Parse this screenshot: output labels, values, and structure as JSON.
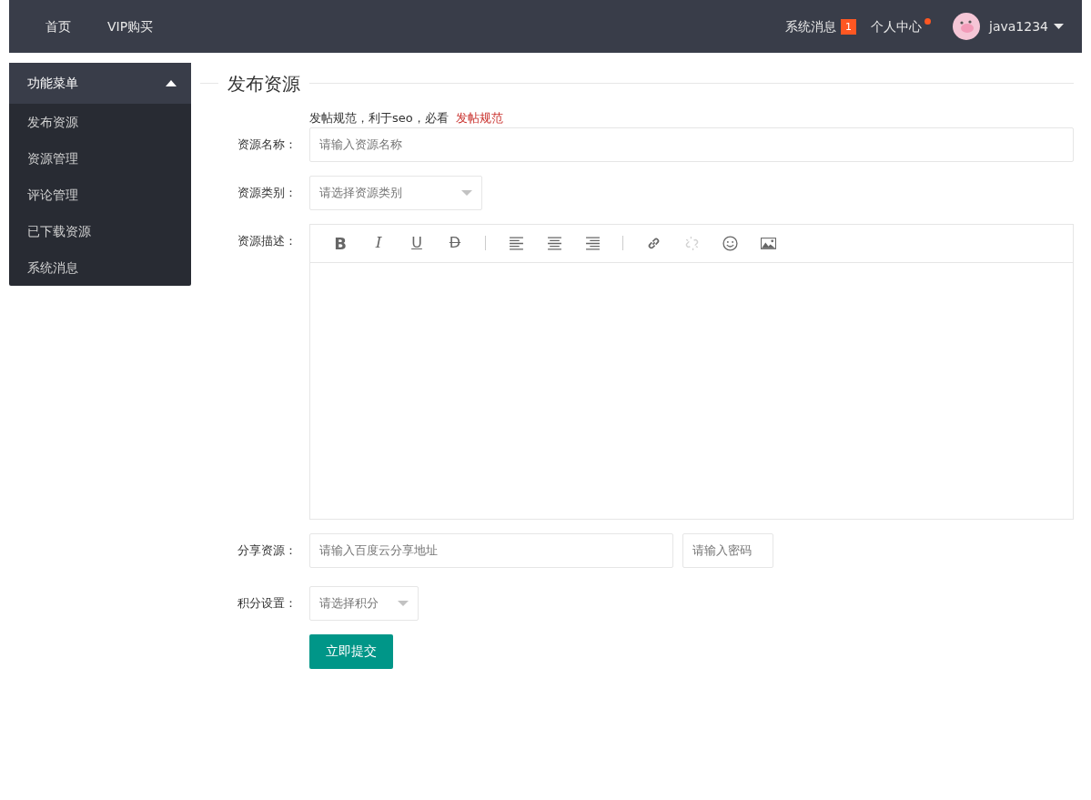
{
  "nav": {
    "links": [
      {
        "label": "首页"
      },
      {
        "label": "VIP购买"
      }
    ],
    "messages": {
      "label": "系统消息",
      "count": "1"
    },
    "profile": {
      "label": "个人中心",
      "dot": true
    },
    "user": {
      "name": "java1234"
    }
  },
  "sidebar": {
    "title": "功能菜单",
    "expanded": true,
    "items": [
      {
        "label": "发布资源"
      },
      {
        "label": "资源管理"
      },
      {
        "label": "评论管理"
      },
      {
        "label": "已下载资源"
      },
      {
        "label": "系统消息"
      }
    ]
  },
  "form": {
    "title": "发布资源",
    "notice": {
      "text": "发帖规范，利于seo，必看",
      "link": "发帖规范"
    },
    "name": {
      "label": "资源名称：",
      "placeholder": "请输入资源名称"
    },
    "category": {
      "label": "资源类别：",
      "placeholder": "请选择资源类别"
    },
    "description": {
      "label": "资源描述：",
      "toolbar": [
        {
          "kind": "glyph",
          "label": "B",
          "disabled": false
        },
        {
          "kind": "glyph",
          "label": "I",
          "disabled": false
        },
        {
          "kind": "glyph",
          "label": "U",
          "disabled": false
        },
        {
          "kind": "glyph",
          "label": "D",
          "disabled": false
        },
        {
          "kind": "separator"
        },
        {
          "kind": "align-left",
          "disabled": false
        },
        {
          "kind": "align-center",
          "disabled": false
        },
        {
          "kind": "align-right",
          "disabled": false
        },
        {
          "kind": "separator"
        },
        {
          "kind": "link",
          "disabled": false
        },
        {
          "kind": "unlink",
          "disabled": true
        },
        {
          "kind": "emoji",
          "disabled": false
        },
        {
          "kind": "image",
          "disabled": false
        }
      ]
    },
    "share": {
      "label": "分享资源：",
      "url_placeholder": "请输入百度云分享地址",
      "password_placeholder": "请输入密码"
    },
    "points": {
      "label": "积分设置：",
      "placeholder": "请选择积分"
    },
    "submit": "立即提交"
  }
}
